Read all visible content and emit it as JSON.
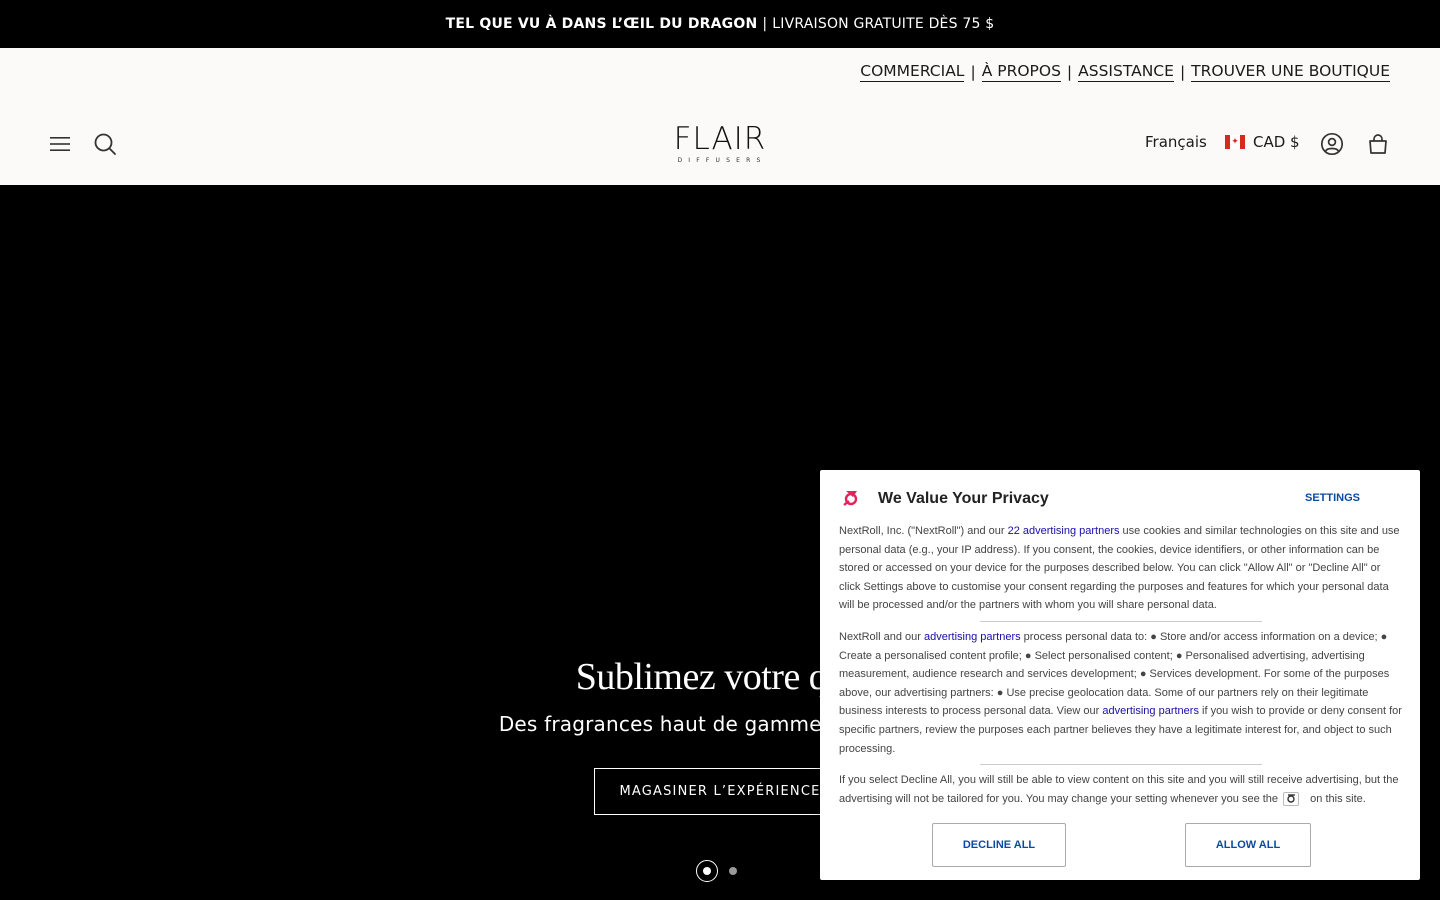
{
  "announcement": {
    "strong": "TEL QUE VU À DANS L’ŒIL DU DRAGON",
    "separator": "|",
    "rest": "LIVRAISON GRATUITE DÈS 75 $"
  },
  "utility_links": [
    {
      "label": "COMMERCIAL"
    },
    {
      "label": "À PROPOS"
    },
    {
      "label": "ASSISTANCE"
    },
    {
      "label": "TROUVER UNE BOUTIQUE"
    }
  ],
  "utility_separator": "|",
  "logo": {
    "word": "FLAIR",
    "sub": "DIFFUSERS"
  },
  "header": {
    "language": "Français",
    "currency": "CAD $"
  },
  "icons": {
    "menu": "hamburger-menu-icon",
    "search": "search-icon",
    "account": "account-icon",
    "cart": "cart-icon",
    "flag": "canada-flag-icon"
  },
  "hero": {
    "title": "Sublimez votre quo",
    "subtitle": "Des fragrances haut de gamme pour transf",
    "cta": "MAGASINER L’EXPÉRIENCE",
    "slides_total": 2,
    "active_slide": 1
  },
  "consent": {
    "title": "We Value Your Privacy",
    "settings_label": "SETTINGS",
    "p1_a": "NextRoll, Inc. (\"NextRoll\") and our ",
    "p1_link": "22 advertising partners",
    "p1_b": " use cookies and similar technologies on this site and use personal data (e.g., your IP address). If you consent, the cookies, device identifiers, or other information can be stored or accessed on your device for the purposes described below. You can click \"Allow All\" or \"Decline All\" or click Settings above to customise your consent regarding the purposes and features for which your personal data will be processed and/or the partners with whom you will share personal data.",
    "p2_a": "NextRoll and our ",
    "p2_link1": "advertising partners",
    "p2_b": " process personal data to: ● Store and/or access information on a device; ● Create a personalised content profile; ● Select personalised content; ● Personalised advertising, advertising measurement, audience research and services development; ● Services development. For some of the purposes above, our advertising partners: ● Use precise geolocation data. Some of our partners rely on their legitimate business interests to process personal data. View our ",
    "p2_link2": "advertising partners",
    "p2_c": " if you wish to provide or deny consent for specific partners, review the purposes each partner believes they have a legitimate interest for, and object to such processing.",
    "p3_a": "If you select Decline All, you will still be able to view content on this site and you will still receive advertising, but the advertising will not be tailored for you. You may change your setting whenever you see the ",
    "p3_b": " on this site.",
    "decline_label": "DECLINE ALL",
    "allow_label": "ALLOW ALL",
    "accent": "#e5225c",
    "link_color": "#1a0dab",
    "button_color": "#0b4aa2"
  }
}
